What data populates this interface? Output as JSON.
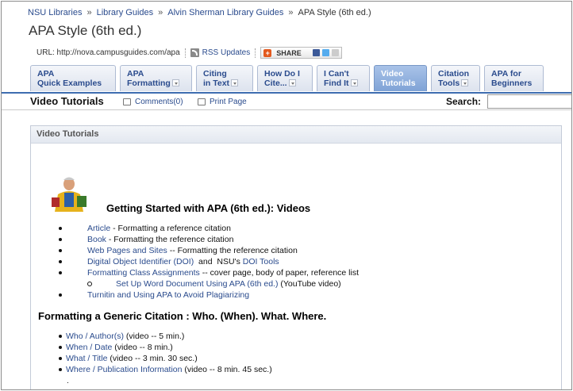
{
  "breadcrumb": {
    "items": [
      "NSU Libraries",
      "Library Guides",
      "Alvin Sherman Library Guides"
    ],
    "separator": "»",
    "current": "APA Style (6th ed.)"
  },
  "page_title": "APA Style (6th ed.)",
  "url_bar": {
    "label": "URL: http://nova.campusguides.com/apa",
    "rss_label": "RSS Updates",
    "share_label": "SHARE"
  },
  "tabs": [
    {
      "line1": "APA",
      "line2": "Quick Examples",
      "dropdown": false,
      "active": false
    },
    {
      "line1": "APA",
      "line2": "Formatting",
      "dropdown": true,
      "active": false
    },
    {
      "line1": "Citing",
      "line2": "in Text",
      "dropdown": true,
      "active": false
    },
    {
      "line1": "How Do I",
      "line2": "Cite...",
      "dropdown": true,
      "active": false
    },
    {
      "line1": "I Can't",
      "line2": "Find It",
      "dropdown": true,
      "active": false
    },
    {
      "line1": "Video",
      "line2": "Tutorials",
      "dropdown": false,
      "active": true
    },
    {
      "line1": "Citation",
      "line2": "Tools",
      "dropdown": true,
      "active": false
    },
    {
      "line1": "APA for",
      "line2": "Beginners",
      "dropdown": false,
      "active": false
    }
  ],
  "subbar": {
    "heading": "Video Tutorials",
    "comments": "Comments(0)",
    "print": "Print Page",
    "search_label": "Search:",
    "search_value": ""
  },
  "box": {
    "header": "Video Tutorials",
    "heading": "Getting Started with APA (6th ed.): Videos",
    "items": [
      {
        "link": "Article",
        "text": " - Formatting a reference citation"
      },
      {
        "link": "Book",
        "text": " - Formatting the reference citation"
      },
      {
        "link": "Web Pages and Sites",
        "text": " -- Formatting the reference citation"
      },
      {
        "link": "Digital Object Identifier (DOI)",
        "text": "  and  NSU's ",
        "link2": "DOI Tools"
      },
      {
        "link": "Formatting Class Assignments",
        "text": " -- cover page, body of paper, reference list"
      },
      {
        "link": "Set Up Word Document Using APA (6th ed.)",
        "text": " (YouTube video)",
        "sub": true
      },
      {
        "link": "Turnitin and Using APA to Avoid Plagiarizing",
        "text": ""
      }
    ],
    "section2_heading": "Formatting a Generic Citation : Who. (When). What. Where.",
    "section2_items": [
      {
        "link": "Who / Author(s)",
        "text": " (video -- 5 min.)"
      },
      {
        "link": "When / Date",
        "text": " (video -- 8 min.)"
      },
      {
        "link": "What / Title",
        "text": " (video -- 3 min. 30 sec.)"
      },
      {
        "link": "Where / Publication Information",
        "text": " (video -- 8 min. 45 sec.)"
      }
    ],
    "trailing": "."
  },
  "colors": {
    "link": "#2a4b8d",
    "active_tab": "#7fa3d6",
    "tab_border": "#3e6db0"
  }
}
